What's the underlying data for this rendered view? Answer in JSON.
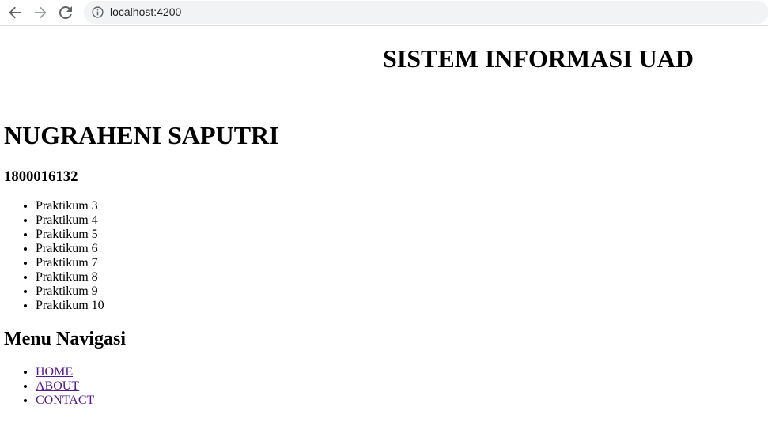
{
  "browser": {
    "url": "localhost:4200",
    "icons": {
      "back": "arrow-left-icon",
      "forward": "arrow-right-icon",
      "reload": "reload-icon",
      "site_info": "info-icon"
    }
  },
  "page": {
    "title": "SISTEM INFORMASI UAD",
    "student": {
      "name": "NUGRAHENI SAPUTRI",
      "id": "1800016132"
    },
    "praktikum": [
      "Praktikum 3",
      "Praktikum 4",
      "Praktikum 5",
      "Praktikum 6",
      "Praktikum 7",
      "Praktikum 8",
      "Praktikum 9",
      "Praktikum 10"
    ],
    "menu": {
      "heading": "Menu Navigasi",
      "links": [
        "HOME",
        "ABOUT",
        "CONTACT"
      ]
    },
    "colors": {
      "visited_link": "#551a8b",
      "omnibox_bg": "#f1f3f4"
    }
  }
}
